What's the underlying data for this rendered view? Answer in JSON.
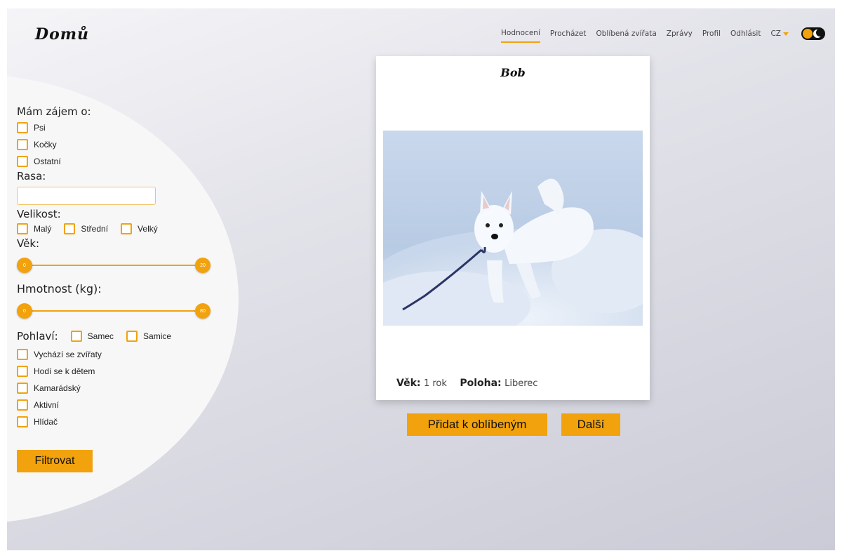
{
  "header": {
    "logo": "Domů",
    "nav": [
      {
        "label": "Hodnocení",
        "active": true
      },
      {
        "label": "Procházet",
        "active": false
      },
      {
        "label": "Oblíbená zvířata",
        "active": false
      },
      {
        "label": "Zprávy",
        "active": false
      },
      {
        "label": "Profil",
        "active": false
      },
      {
        "label": "Odhlásit",
        "active": false
      }
    ],
    "language": "CZ",
    "theme_toggle": "dark-mode-toggle"
  },
  "filter": {
    "interest_title": "Mám zájem o:",
    "interest_options": [
      "Psi",
      "Kočky",
      "Ostatní"
    ],
    "breed_title": "Rasa:",
    "breed_value": "",
    "size_title": "Velikost:",
    "size_options": [
      "Malý",
      "Střední",
      "Velký"
    ],
    "age_title": "Věk:",
    "age_min": "0",
    "age_max": "20",
    "weight_title": "Hmotnost (kg):",
    "weight_min": "0",
    "weight_max": "80",
    "gender_title": "Pohlaví:",
    "gender_options": [
      "Samec",
      "Samice"
    ],
    "trait_options": [
      "Vychází se zvířaty",
      "Hodí se k dětem",
      "Kamarádský",
      "Aktivní",
      "Hlídač"
    ],
    "submit_label": "Filtrovat"
  },
  "card": {
    "name": "Bob",
    "age_label": "Věk:",
    "age_value": "1 rok",
    "location_label": "Poloha:",
    "location_value": "Liberec"
  },
  "actions": {
    "favorite_label": "Přidat k oblíbeným",
    "next_label": "Další"
  },
  "colors": {
    "accent": "#f2a20c",
    "background": "#e3e3ea"
  }
}
